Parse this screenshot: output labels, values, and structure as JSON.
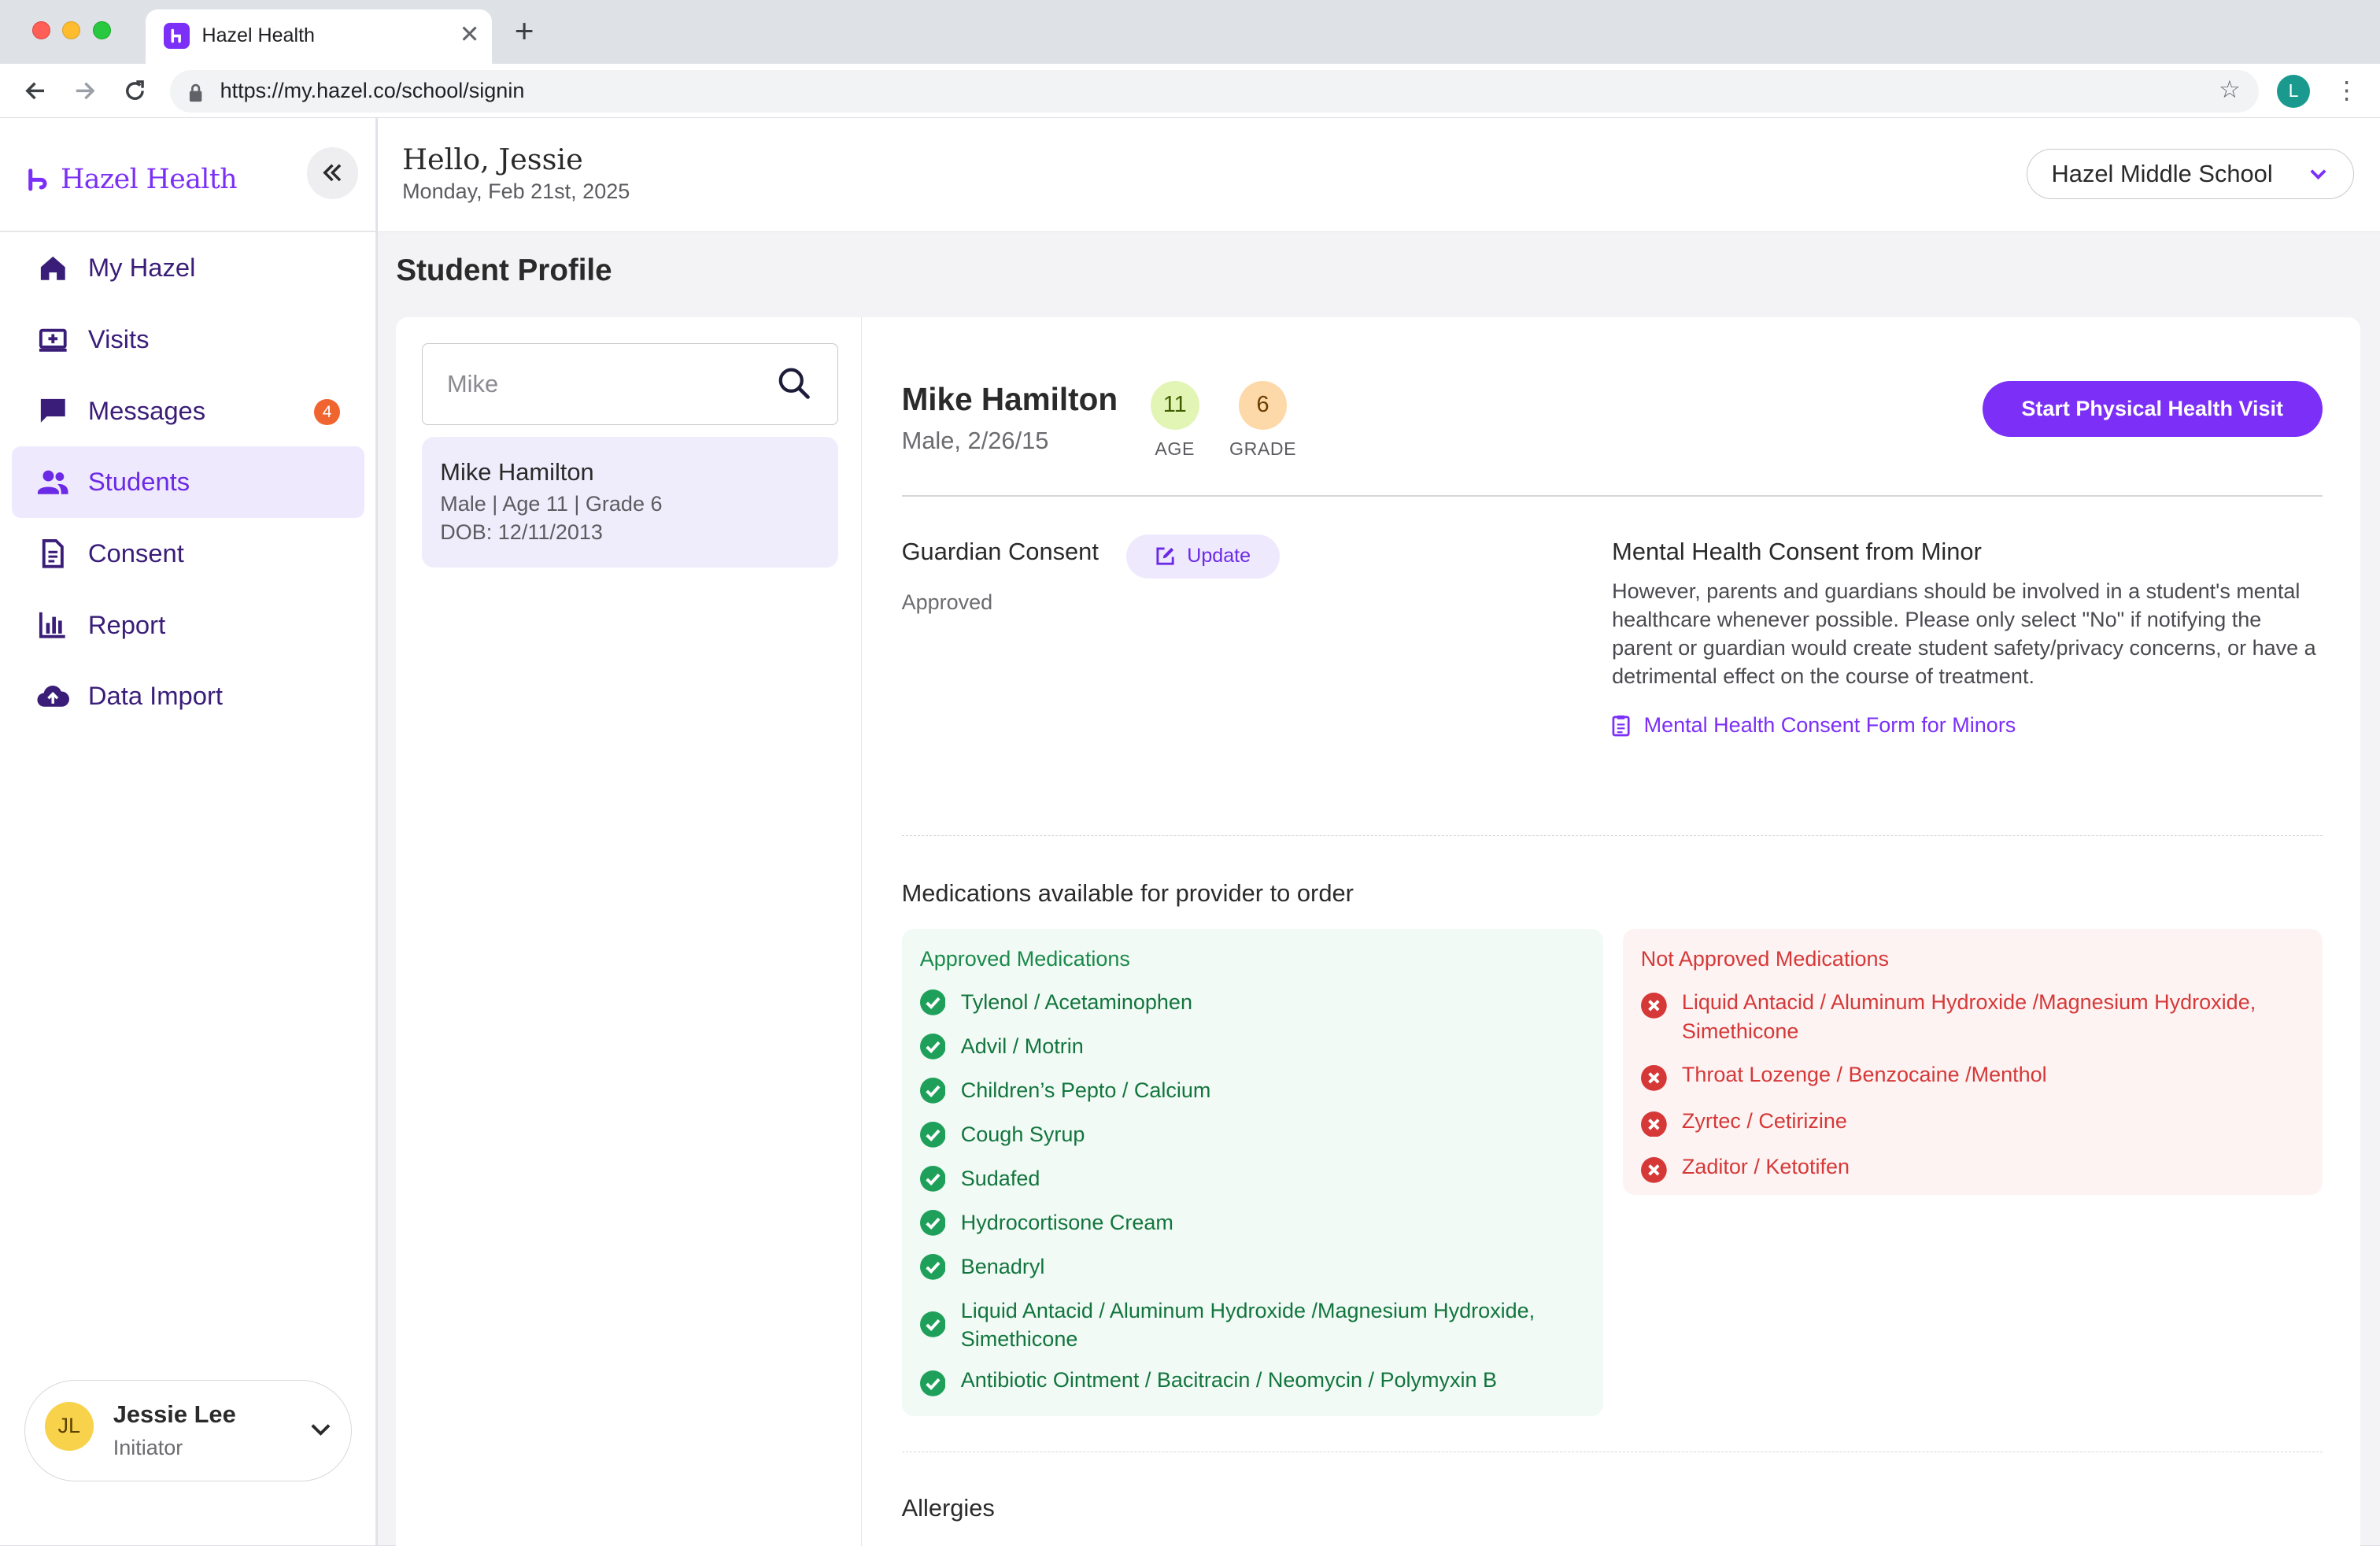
{
  "browser": {
    "tab_title": "Hazel Health",
    "url": "https://my.hazel.co/school/signin",
    "profile_initial": "L"
  },
  "sidebar": {
    "brand": "Hazel Health",
    "nav": [
      {
        "label": "My Hazel",
        "icon": "home-icon"
      },
      {
        "label": "Visits",
        "icon": "visits-icon"
      },
      {
        "label": "Messages",
        "icon": "message-icon",
        "badge": "4"
      },
      {
        "label": "Students",
        "icon": "students-icon",
        "active": true
      },
      {
        "label": "Consent",
        "icon": "document-icon"
      },
      {
        "label": "Report",
        "icon": "chart-icon"
      },
      {
        "label": "Data Import",
        "icon": "cloud-upload-icon"
      }
    ],
    "user": {
      "initials": "JL",
      "name": "Jessie Lee",
      "role": "Initiator"
    }
  },
  "header": {
    "greeting": "Hello, Jessie",
    "date": "Monday, Feb 21st, 2025",
    "school": "Hazel Middle School"
  },
  "page": {
    "title": "Student Profile"
  },
  "search": {
    "value": "Mike"
  },
  "student_card": {
    "name": "Mike Hamilton",
    "meta": "Male |  Age 11  | Grade 6",
    "dob": "DOB: 12/11/2013"
  },
  "profile": {
    "name": "Mike Hamilton",
    "sub": "Male, 2/26/15",
    "age_value": "11",
    "age_label": "AGE",
    "grade_value": "6",
    "grade_label": "GRADE",
    "start_button": "Start Physical Health Visit"
  },
  "consent": {
    "guardian_title": "Guardian Consent",
    "update_label": "Update",
    "guardian_status": "Approved",
    "mh_title": "Mental Health Consent from Minor",
    "mh_text": "However, parents and guardians should be involved in a student's mental healthcare whenever possible. Please only select \"No\" if notifying the parent or guardian would create student safety/privacy concerns, or have a detrimental effect on the course of treatment.",
    "mh_link": "Mental Health Consent Form for Minors"
  },
  "medications": {
    "title": "Medications available for provider to order",
    "approved_title": "Approved Medications",
    "approved": [
      "Tylenol / Acetaminophen",
      "Advil / Motrin",
      "Children’s Pepto / Calcium",
      "Cough Syrup",
      "Sudafed",
      "Hydrocortisone Cream",
      "Benadryl",
      "Liquid Antacid / Aluminum Hydroxide /Magnesium Hydroxide, Simethicone",
      "Antibiotic Ointment / Bacitracin / Neomycin / Polymyxin B"
    ],
    "not_approved_title": "Not Approved Medications",
    "not_approved": [
      "Liquid Antacid / Aluminum Hydroxide /Magnesium Hydroxide, Simethicone",
      "Throat Lozenge / Benzocaine /Menthol",
      "Zyrtec / Cetirizine",
      "Zaditor / Ketotifen"
    ]
  },
  "allergies": {
    "title": "Allergies"
  },
  "colors": {
    "brand": "#7b2ff7",
    "approved": "#1a8a4a",
    "not_approved": "#d63838",
    "badge": "#f0642f"
  }
}
